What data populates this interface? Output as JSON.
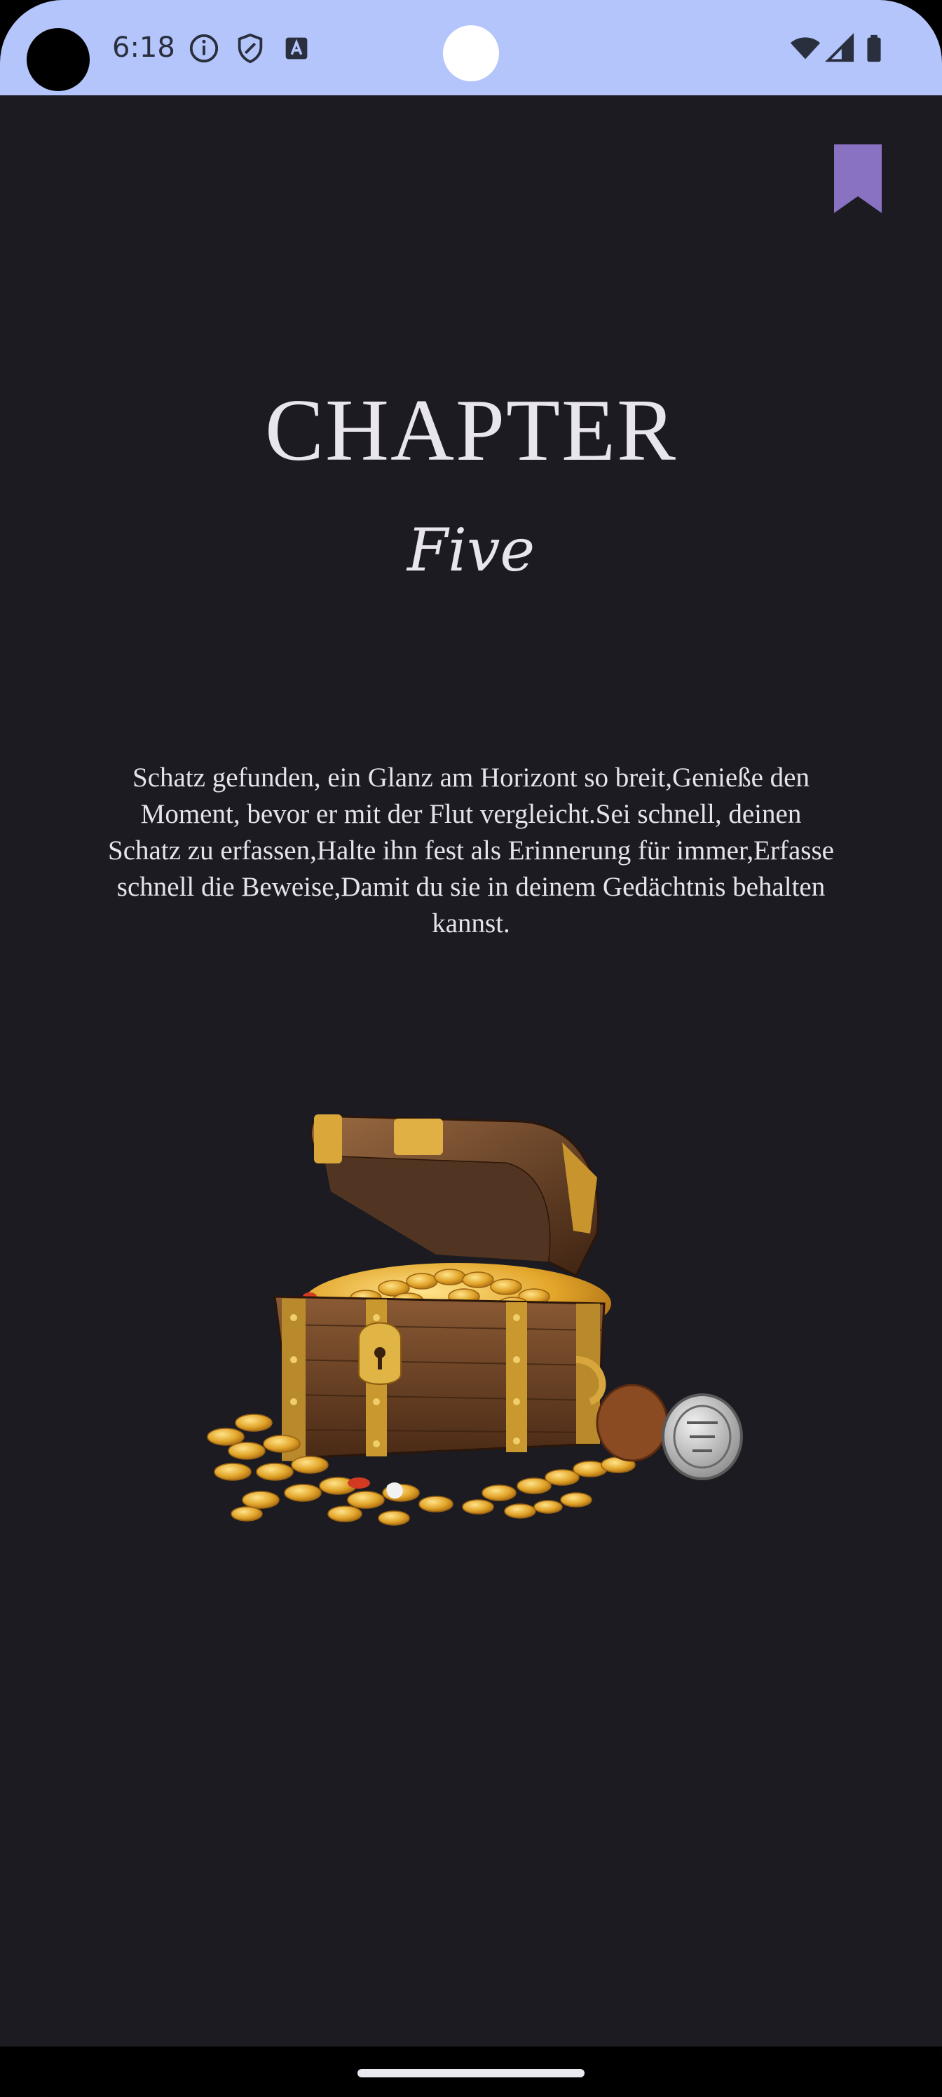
{
  "status_bar": {
    "time": "6:18",
    "icons_left": [
      "info-icon",
      "shield-icon",
      "text-a-icon"
    ],
    "icons_right": [
      "wifi-icon",
      "cell-signal-icon",
      "battery-icon"
    ],
    "background": "#b4c5fc"
  },
  "toolbar": {
    "bookmark_icon": "bookmark-icon",
    "bookmark_color": "#8a72c2"
  },
  "chapter": {
    "title": "CHAPTER",
    "subtitle": "Five",
    "text": "Schatz gefunden, ein Glanz am Horizont so breit,Genieße den Moment, bevor er mit der Flut vergleicht.Sei schnell, deinen Schatz zu erfassen,Halte ihn fest als Erinnerung für immer,Erfasse schnell die Beweise,Damit du sie in deinem Gedächtnis behalten kannst.",
    "illustration": "treasure-chest-illustration"
  },
  "theme": {
    "background": "#1b1b21",
    "text": "#e8e6ec"
  }
}
